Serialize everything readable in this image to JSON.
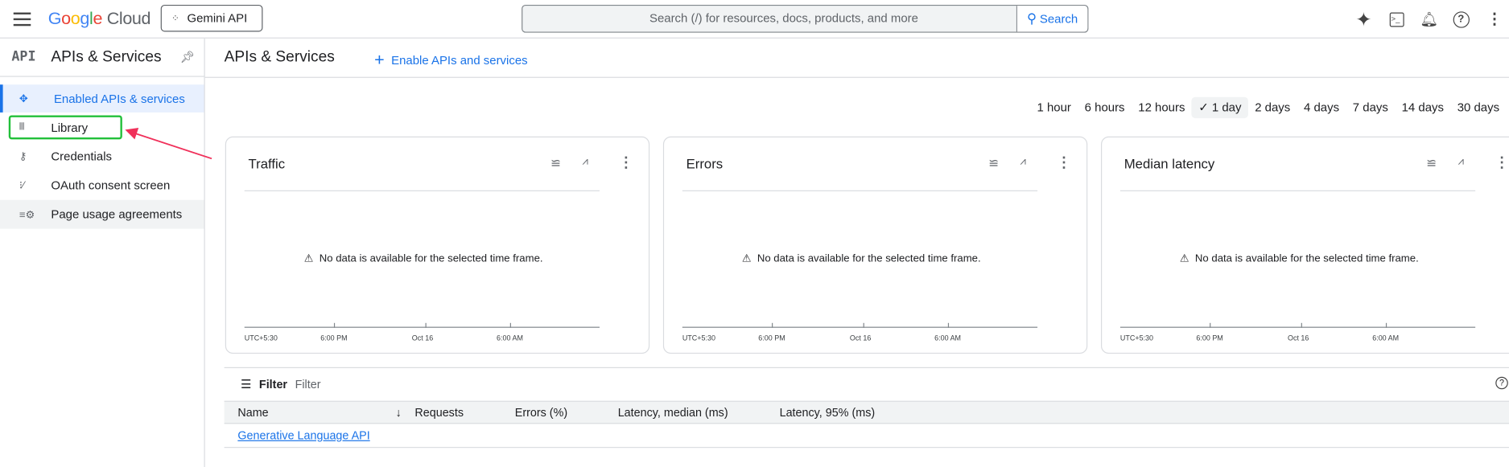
{
  "topbar": {
    "logo": "Google Cloud",
    "project": "Gemini API",
    "search_placeholder": "Search (/) for resources, docs, products, and more",
    "search_button": "Search"
  },
  "sidebar": {
    "badge": "API",
    "title": "APIs & Services",
    "items": [
      {
        "label": "Enabled APIs & services",
        "icon": "enabled-apis-icon",
        "active": true
      },
      {
        "label": "Library",
        "icon": "library-icon",
        "highlighted": true
      },
      {
        "label": "Credentials",
        "icon": "key-icon"
      },
      {
        "label": "OAuth consent screen",
        "icon": "oauth-icon"
      },
      {
        "label": "Page usage agreements",
        "icon": "settings-list-icon"
      }
    ]
  },
  "main": {
    "title": "APIs & Services",
    "enable_label": "Enable APIs and services",
    "time_ranges": [
      "1 hour",
      "6 hours",
      "12 hours",
      "1 day",
      "2 days",
      "4 days",
      "7 days",
      "14 days",
      "30 days"
    ],
    "selected_range": "1 day",
    "cards": [
      {
        "title": "Traffic",
        "message": "No data is available for the selected time frame.",
        "ticks": [
          "UTC+5:30",
          "6:00 PM",
          "Oct 16",
          "6:00 AM"
        ]
      },
      {
        "title": "Errors",
        "message": "No data is available for the selected time frame.",
        "ticks": [
          "UTC+5:30",
          "6:00 PM",
          "Oct 16",
          "6:00 AM"
        ]
      },
      {
        "title": "Median latency",
        "message": "No data is available for the selected time frame.",
        "ticks": [
          "UTC+5:30",
          "6:00 PM",
          "Oct 16",
          "6:00 AM"
        ]
      }
    ],
    "filter_label": "Filter",
    "filter_placeholder": "Filter",
    "table": {
      "columns": [
        "Name",
        "Requests",
        "Errors (%)",
        "Latency, median (ms)",
        "Latency, 95% (ms)"
      ],
      "rows": [
        [
          "Generative Language API"
        ]
      ]
    }
  },
  "colors": {
    "accent": "#1a73e8",
    "highlight_box": "#22c03a",
    "arrow": "#f0305a",
    "active_bg": "#e8f0fe"
  }
}
